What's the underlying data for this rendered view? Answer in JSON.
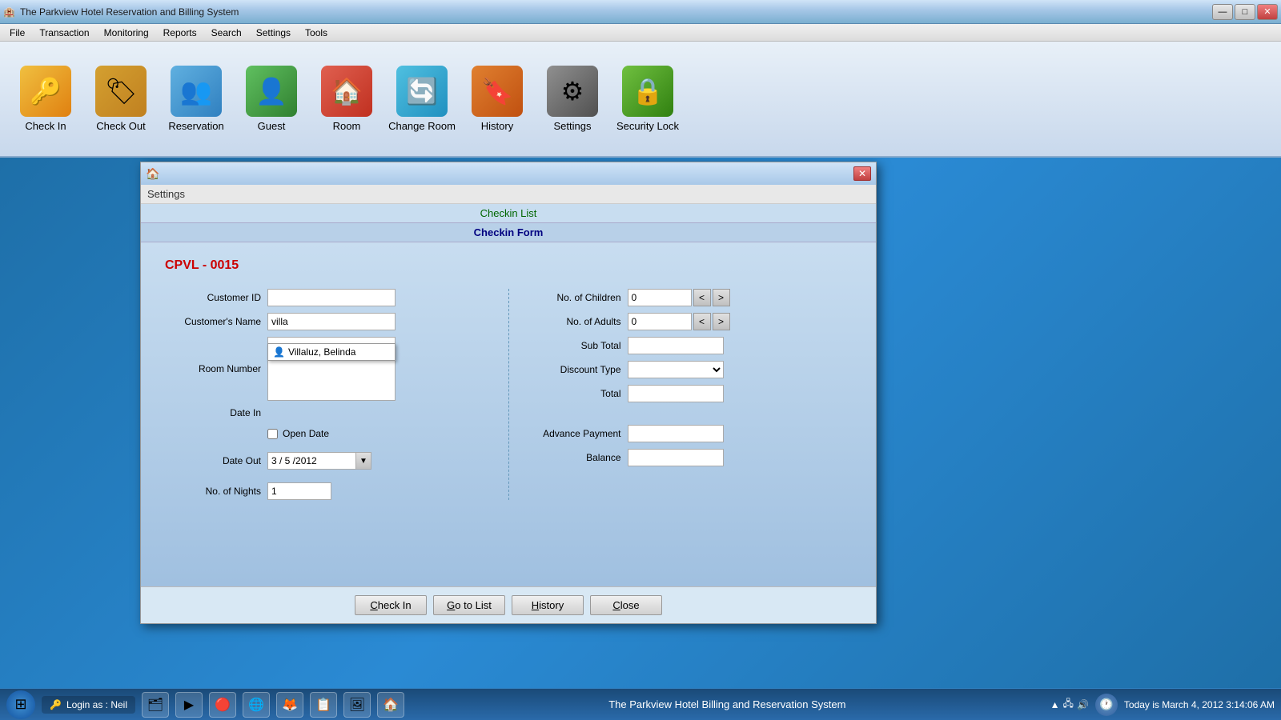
{
  "app": {
    "title": "The Parkview Hotel Reservation and Billing System",
    "title_icon": "🏨"
  },
  "title_controls": {
    "minimize": "—",
    "maximize": "□",
    "close": "✕"
  },
  "menu": {
    "items": [
      "File",
      "Transaction",
      "Monitoring",
      "Reports",
      "Search",
      "Settings",
      "Tools"
    ]
  },
  "toolbar": {
    "buttons": [
      {
        "id": "checkin",
        "label": "Check In",
        "icon": "🔑",
        "icon_class": "icon-checkin"
      },
      {
        "id": "checkout",
        "label": "Check Out",
        "icon": "🏷",
        "icon_class": "icon-checkout"
      },
      {
        "id": "reservation",
        "label": "Reservation",
        "icon": "👥",
        "icon_class": "icon-reservation"
      },
      {
        "id": "guest",
        "label": "Guest",
        "icon": "👤",
        "icon_class": "icon-guest"
      },
      {
        "id": "room",
        "label": "Room",
        "icon": "🏠",
        "icon_class": "icon-room"
      },
      {
        "id": "changeroom",
        "label": "Change Room",
        "icon": "🔄",
        "icon_class": "icon-changeroom"
      },
      {
        "id": "history",
        "label": "History",
        "icon": "🔖",
        "icon_class": "icon-history"
      },
      {
        "id": "settings",
        "label": "Settings",
        "icon": "⚙",
        "icon_class": "icon-settings"
      },
      {
        "id": "securitylock",
        "label": "Security Lock",
        "icon": "🔒",
        "icon_class": "icon-securitylock"
      }
    ]
  },
  "dialog": {
    "settings_label": "Settings",
    "checkin_list_label": "Checkin List",
    "checkin_form_label": "Checkin Form",
    "form_id": "CPVL - 0015",
    "fields": {
      "customer_id_label": "Customer ID",
      "customer_name_label": "Customer's Name",
      "customer_name_value": "villa",
      "room_number_label": "Room Number",
      "date_in_label": "Date In",
      "open_date_label": "Open Date",
      "date_out_label": "Date Out",
      "date_out_value": "3 / 5 /2012",
      "no_nights_label": "No. of Nights",
      "no_nights_value": "1",
      "no_children_label": "No. of Children",
      "no_children_value": "0",
      "no_adults_label": "No. of Adults",
      "no_adults_value": "0",
      "sub_total_label": "Sub Total",
      "discount_type_label": "Discount Type",
      "total_label": "Total",
      "advance_payment_label": "Advance Payment",
      "balance_label": "Balance"
    },
    "autocomplete": {
      "item": "Villaluz, Belinda"
    },
    "buttons": [
      {
        "id": "checkin",
        "label": "Check In",
        "underline": "C"
      },
      {
        "id": "gotolist",
        "label": "Go to List",
        "underline": "G"
      },
      {
        "id": "history",
        "label": "History",
        "underline": "H"
      },
      {
        "id": "close",
        "label": "Close",
        "underline": "C"
      }
    ]
  },
  "taskbar": {
    "login_icon": "🔑",
    "login_text": "Login as : Neil",
    "center_text": "The Parkview Hotel Billing and Reservation System",
    "clock_icon": "🕐",
    "datetime": "Today is March 4, 2012  3:14:06 AM",
    "time": "3:14 AM",
    "apps": [
      "🗂",
      "▶",
      "🔴",
      "🌐",
      "🦊",
      "📋",
      "🖼",
      "🏠"
    ]
  }
}
